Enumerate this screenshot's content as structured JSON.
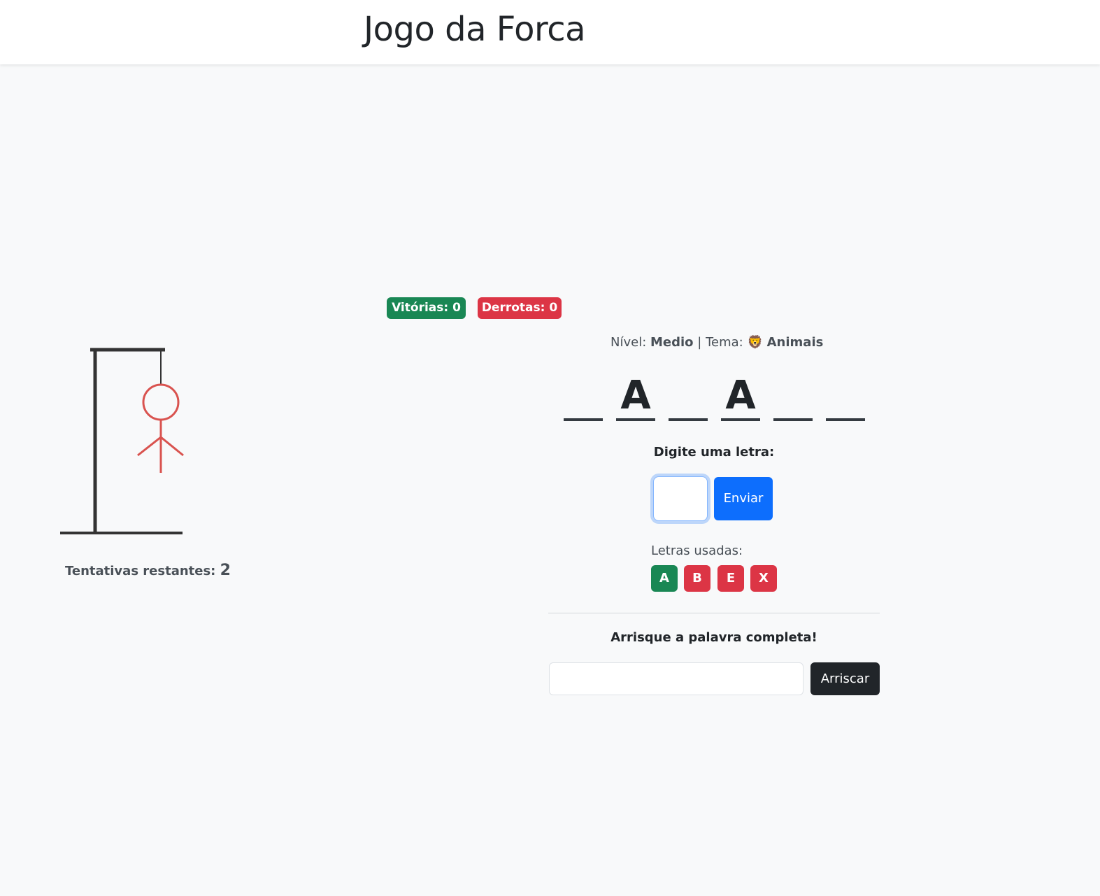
{
  "header": {
    "title": "Jogo da Forca"
  },
  "scoreboard": {
    "wins_label": "Vitórias: 0",
    "losses_label": "Derrotas: 0"
  },
  "hangman": {
    "attempts_label": "Tentativas restantes:",
    "attempts_remaining": "2",
    "parts_shown": [
      "head",
      "body",
      "left-arm",
      "right-arm"
    ]
  },
  "info": {
    "level_label": "Nível:",
    "level_value": "Medio",
    "separator": "|",
    "theme_label": "Tema:",
    "theme_icon": "🦁",
    "theme_value": "Animais"
  },
  "word": {
    "slots": [
      "",
      "A",
      "",
      "A",
      "",
      ""
    ]
  },
  "letter_guess": {
    "prompt": "Digite uma letra:",
    "input_value": "",
    "submit_label": "Enviar"
  },
  "used_letters": {
    "label": "Letras usadas:",
    "letters": [
      {
        "letter": "A",
        "status": "correct"
      },
      {
        "letter": "B",
        "status": "wrong"
      },
      {
        "letter": "E",
        "status": "wrong"
      },
      {
        "letter": "X",
        "status": "wrong"
      }
    ]
  },
  "word_guess": {
    "prompt": "Arrisque a palavra completa!",
    "input_value": "",
    "submit_label": "Arriscar"
  },
  "colors": {
    "success": "#198754",
    "danger": "#dc3545",
    "primary": "#0d6efd",
    "dark": "#212529",
    "hangman_figure": "#d9534f",
    "gallows": "#333333"
  }
}
